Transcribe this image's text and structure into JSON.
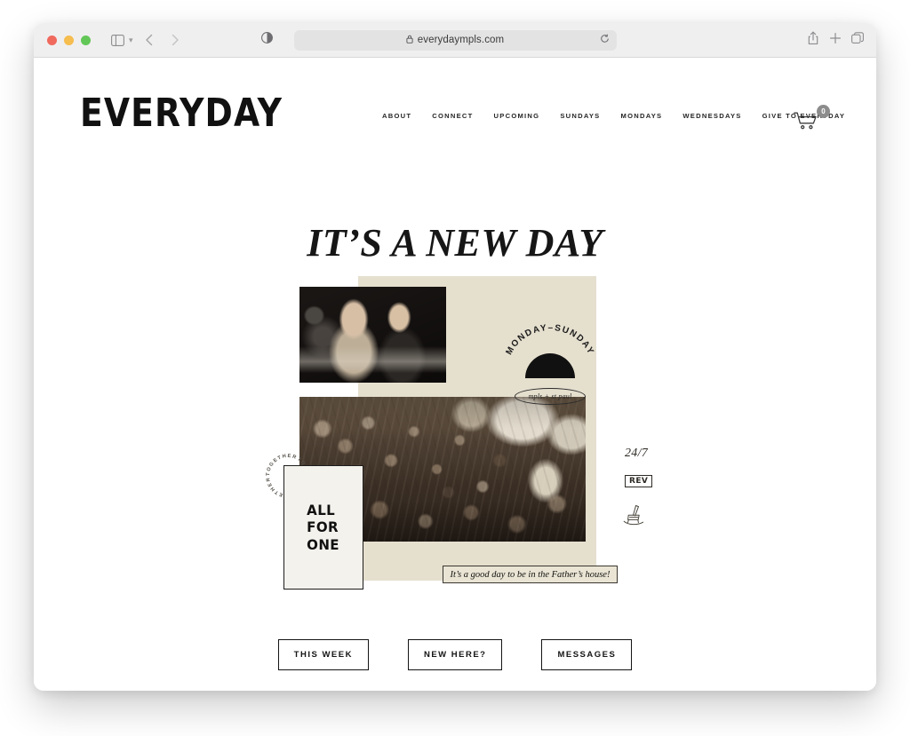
{
  "browser": {
    "url": "everydaympls.com",
    "lock_icon": "lock-icon",
    "reader_icon": "reader-mode-icon",
    "reload_icon": "reload-icon",
    "sidebar_icon": "sidebar-toggle-icon",
    "back_icon": "back-arrow-icon",
    "forward_icon": "forward-arrow-icon",
    "share_icon": "share-icon",
    "newtab_icon": "plus-icon",
    "tabs_icon": "tab-overview-icon",
    "traffic_lights": [
      "close",
      "minimize",
      "zoom"
    ]
  },
  "site": {
    "logo": "EVERYDAY",
    "nav": [
      {
        "label": "ABOUT"
      },
      {
        "label": "CONNECT"
      },
      {
        "label": "UPCOMING"
      },
      {
        "label": "SUNDAYS"
      },
      {
        "label": "MONDAYS"
      },
      {
        "label": "WEDNESDAYS"
      },
      {
        "label": "GIVE TO EVERYDAY"
      }
    ],
    "cart": {
      "icon": "shopping-cart-icon",
      "count": "0"
    }
  },
  "hero": {
    "title": "IT’S A NEW DAY"
  },
  "collage": {
    "badge_arc_text": "MONDAY–SUNDAY",
    "badge_pill_text": "mpls + st paul",
    "mark_247": "24/7",
    "mark_rev": "REV",
    "chair_icon": "rocking-chair-icon",
    "together_text": "TOGETHER",
    "card_line1": "ALL",
    "card_line2": "FOR",
    "card_line3": "ONE",
    "quote": "It’s a good day to be in the Father’s house!",
    "photo_stage_alt": "two speakers on stage with microphone",
    "photo_crowd_alt": "crowd with raised hands in worship"
  },
  "cta": [
    {
      "label": "THIS WEEK"
    },
    {
      "label": "NEW HERE?"
    },
    {
      "label": "MESSAGES"
    }
  ],
  "colors": {
    "cream": "#e5dfce",
    "card_cream": "#f4f2ec",
    "ink": "#111111",
    "badge_grey": "#8c8c8c"
  }
}
